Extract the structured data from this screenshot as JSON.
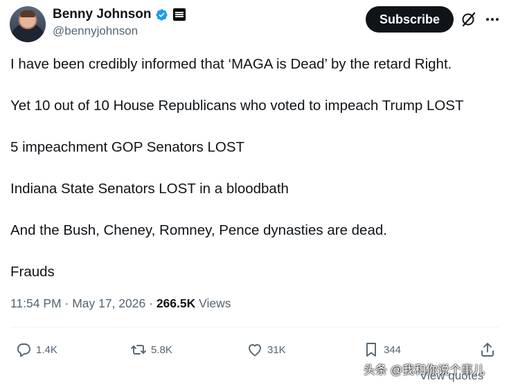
{
  "author": {
    "display_name": "Benny Johnson",
    "handle": "@bennyjohnson",
    "verified_color": "#1d9bf0"
  },
  "header": {
    "subscribe_label": "Subscribe",
    "grok_icon": "grok-icon",
    "more_icon": "more-icon"
  },
  "tweet": {
    "lines": [
      "I have been credibly informed that ‘MAGA is Dead’ by the retard Right.",
      "Yet 10 out of 10 House Republicans who voted to impeach Trump LOST",
      "5 impeachment GOP Senators LOST",
      "Indiana State Senators LOST in a bloodbath",
      "And the Bush, Cheney, Romney, Pence dynasties are dead.",
      "Frauds"
    ]
  },
  "meta": {
    "time": "11:54 PM",
    "separator": "·",
    "date": "May 17, 2026",
    "views_count": "266.5K",
    "views_label": "Views"
  },
  "actions": {
    "replies": "1.4K",
    "reposts": "5.8K",
    "likes": "31K",
    "bookmarks": "344"
  },
  "footer": {
    "view_quotes": "View quotes",
    "watermark": "头条 @我和你说个事儿"
  }
}
